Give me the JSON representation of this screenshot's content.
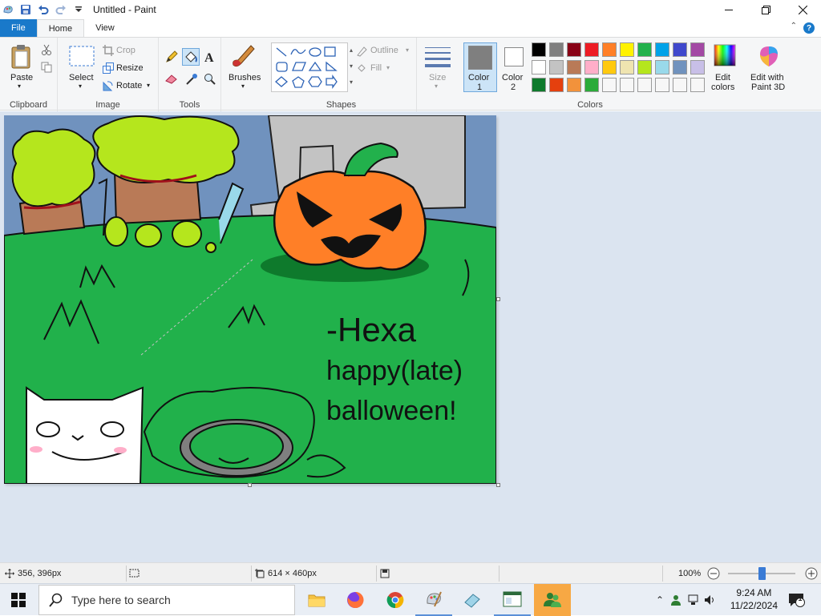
{
  "window": {
    "title": "Untitled - Paint"
  },
  "tabs": {
    "file": "File",
    "home": "Home",
    "view": "View"
  },
  "clipboard": {
    "paste": "Paste",
    "group": "Clipboard"
  },
  "image": {
    "select": "Select",
    "crop": "Crop",
    "resize": "Resize",
    "rotate": "Rotate",
    "group": "Image"
  },
  "tools": {
    "group": "Tools"
  },
  "brushes": {
    "label": "Brushes"
  },
  "shapes": {
    "outline": "Outline",
    "fill": "Fill",
    "group": "Shapes"
  },
  "size": {
    "label": "Size"
  },
  "colors": {
    "color1_label": "Color",
    "color1_num": "1",
    "color2_label": "Color",
    "color2_num": "2",
    "edit_colors_line1": "Edit",
    "edit_colors_line2": "colors",
    "paint3d_line1": "Edit with",
    "paint3d_line2": "Paint 3D",
    "group": "Colors",
    "color1_value": "#7f7f7f",
    "color2_value": "#ffffff",
    "palette": [
      "#000000",
      "#7f7f7f",
      "#880015",
      "#ed1c24",
      "#ff7f27",
      "#fff200",
      "#22b14c",
      "#00a2e8",
      "#3f48cc",
      "#a349a4",
      "#ffffff",
      "#c3c3c3",
      "#b97a57",
      "#ffaec9",
      "#ffc90e",
      "#efe4b0",
      "#b5e61d",
      "#99d9ea",
      "#7092be",
      "#c8bfe7",
      "#0e7a2c",
      "#e5400e",
      "#f2923b",
      "#2bab3a",
      "#f7f7f7",
      "#f7f7f7",
      "#f7f7f7",
      "#f7f7f7",
      "#f7f7f7",
      "#f7f7f7"
    ]
  },
  "drawing": {
    "signature": "-Hexa",
    "greeting_line1": "happy(late)",
    "greeting_line2": "balloween!"
  },
  "status": {
    "cursor": "356, 396px",
    "size": "614 × 460px",
    "zoom": "100%",
    "zoom_level": 0.5
  },
  "taskbar": {
    "search_placeholder": "Type here to search",
    "time": "9:24 AM",
    "date": "11/22/2024",
    "notifications": "1"
  }
}
